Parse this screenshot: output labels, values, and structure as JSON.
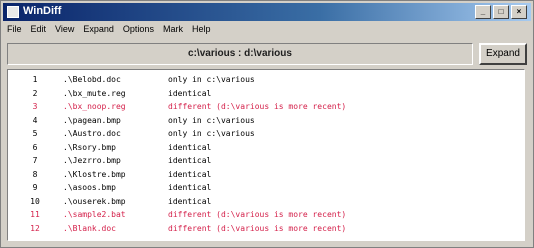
{
  "window": {
    "title": "WinDiff"
  },
  "menu": [
    "File",
    "Edit",
    "View",
    "Expand",
    "Options",
    "Mark",
    "Help"
  ],
  "header": {
    "folders": "c:\\various : d:\\various",
    "expand_label": "Expand"
  },
  "colors": {
    "identical": "#000000",
    "different": "#d4204a"
  },
  "rows": [
    {
      "num": "1",
      "name": ".\\Belobd.doc",
      "status": "only in c:\\various",
      "type": "normal"
    },
    {
      "num": "2",
      "name": ".\\bx_mute.reg",
      "status": "identical",
      "type": "normal"
    },
    {
      "num": "3",
      "name": ".\\bx_noop.reg",
      "status": "different (d:\\various is more recent)",
      "type": "different"
    },
    {
      "num": "4",
      "name": ".\\pagean.bmp",
      "status": "only in c:\\various",
      "type": "normal"
    },
    {
      "num": "5",
      "name": ".\\Austro.doc",
      "status": "only in c:\\various",
      "type": "normal"
    },
    {
      "num": "6",
      "name": ".\\Rsory.bmp",
      "status": "identical",
      "type": "normal"
    },
    {
      "num": "7",
      "name": ".\\Jezrro.bmp",
      "status": "identical",
      "type": "normal"
    },
    {
      "num": "8",
      "name": ".\\Klostre.bmp",
      "status": "identical",
      "type": "normal"
    },
    {
      "num": "9",
      "name": ".\\asoos.bmp",
      "status": "identical",
      "type": "normal"
    },
    {
      "num": "10",
      "name": ".\\ouserek.bmp",
      "status": "identical",
      "type": "normal"
    },
    {
      "num": "11",
      "name": ".\\sample2.bat",
      "status": "different (d:\\various is more recent)",
      "type": "different"
    },
    {
      "num": "12",
      "name": ".\\Blank.doc",
      "status": "different (d:\\various is more recent)",
      "type": "different"
    }
  ]
}
